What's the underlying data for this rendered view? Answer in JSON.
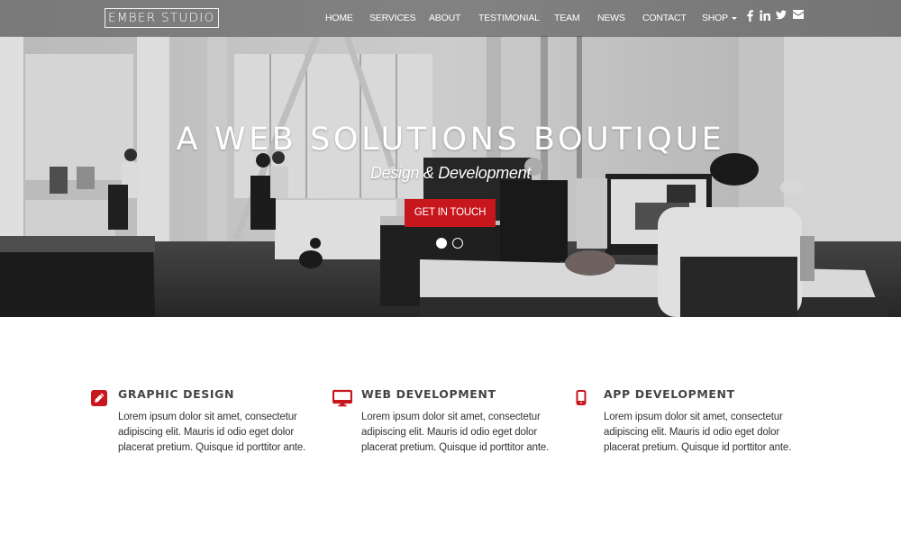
{
  "brand": {
    "name": "EMBER STUDIO"
  },
  "nav": {
    "items": [
      {
        "label": "HOME"
      },
      {
        "label": "SERVICES"
      },
      {
        "label": "ABOUT"
      },
      {
        "label": "TESTIMONIAL"
      },
      {
        "label": "TEAM"
      },
      {
        "label": "NEWS"
      },
      {
        "label": "CONTACT"
      },
      {
        "label": "SHOP",
        "dropdown": true
      }
    ],
    "social": [
      {
        "icon": "facebook-icon"
      },
      {
        "icon": "linkedin-icon"
      },
      {
        "icon": "twitter-icon"
      },
      {
        "icon": "envelope-icon"
      }
    ]
  },
  "hero": {
    "title": "A WEB SOLUTIONS BOUTIQUE",
    "subtitle": "Design & Development",
    "cta_label": "GET IN TOUCH",
    "slides": {
      "count": 2,
      "active": 1
    },
    "image_description": "Black and white open-plan office with people working at computers"
  },
  "features": [
    {
      "icon": "pencil-icon",
      "title": "GRAPHIC DESIGN",
      "text": "Lorem ipsum dolor sit amet, consectetur adipiscing elit. Mauris id odio eget dolor placerat pretium. Quisque id porttitor ante."
    },
    {
      "icon": "desktop-icon",
      "title": "WEB DEVELOPMENT",
      "text": "Lorem ipsum dolor sit amet, consectetur adipiscing elit. Mauris id odio eget dolor placerat pretium. Quisque id porttitor ante."
    },
    {
      "icon": "mobile-phone-icon",
      "title": "APP DEVELOPMENT",
      "text": "Lorem ipsum dolor sit amet, consectetur adipiscing elit. Mauris id odio eget dolor placerat pretium. Quisque id porttitor ante."
    }
  ],
  "colors": {
    "accent": "#c8161d",
    "heading": "#444444",
    "body_text": "#333333",
    "navbar_bg": "rgba(70,70,70,0.55)"
  }
}
